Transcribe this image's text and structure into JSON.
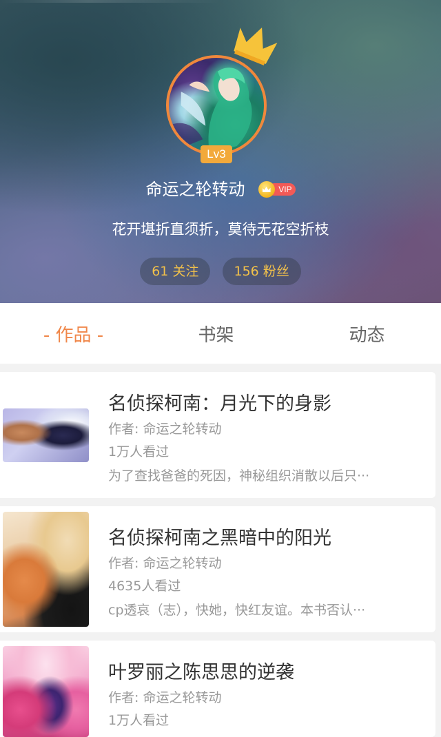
{
  "profile": {
    "level": "Lv3",
    "username": "命运之轮转动",
    "vip_label": "VIP",
    "signature": "花开堪折直须折，莫待无花空折枝",
    "following": "61 关注",
    "followers": "156 粉丝"
  },
  "tabs": [
    {
      "label": "- 作品 -",
      "active": true
    },
    {
      "label": "书架",
      "active": false
    },
    {
      "label": "动态",
      "active": false
    }
  ],
  "works": [
    {
      "title": "名侦探柯南：月光下的身影",
      "author": "作者: 命运之轮转动",
      "views": "1万人看过",
      "description": "为了查找爸爸的死因，神秘组织消散以后只···"
    },
    {
      "title": "名侦探柯南之黑暗中的阳光",
      "author": "作者: 命运之轮转动",
      "views": "4635人看过",
      "description": "cp透哀（志），快她，快红友谊。本书否认···"
    },
    {
      "title": "叶罗丽之陈思思的逆袭",
      "author": "作者: 命运之轮转动",
      "views": "1万人看过",
      "description": ""
    }
  ],
  "colors": {
    "accent": "#f0874a",
    "avatar_border": "#f0883c",
    "level_badge": "#f2a93b",
    "stat_text": "#f2c14a",
    "vip_pill": "#f35a56"
  },
  "icons": {
    "crown": "crown-icon",
    "vip_coin": "vip-crown-coin-icon"
  }
}
